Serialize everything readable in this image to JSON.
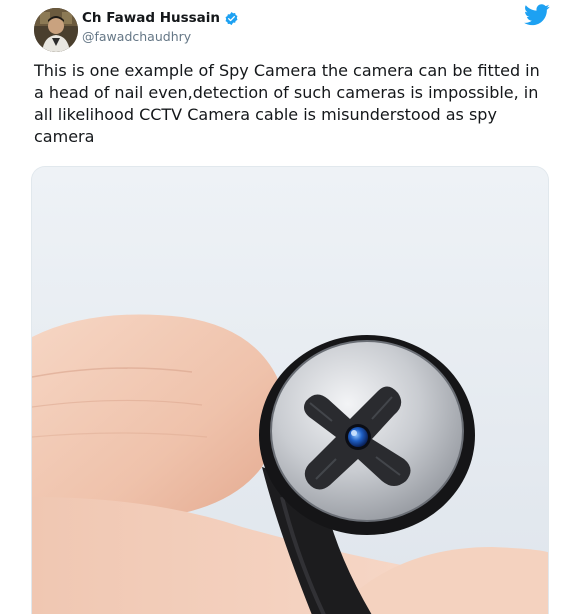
{
  "tweet": {
    "author": {
      "display_name": "Ch Fawad Hussain",
      "handle": "@fawadchaudhry",
      "verified": true,
      "avatar_icon": "profile-photo"
    },
    "text": "This is one example of Spy Camera the camera can be fitted in a head of nail even,detection of such cameras is impossible, in all likelihood CCTV Camera cable is misunderstood as spy camera",
    "brand_icon": "twitter-bird-icon",
    "media": {
      "type": "photo",
      "subject": "screw-head spy camera held between fingers"
    }
  },
  "colors": {
    "twitter_blue": "#1da1f2",
    "text_primary": "#14171a",
    "text_secondary": "#657786",
    "border": "#e1e8ed"
  }
}
